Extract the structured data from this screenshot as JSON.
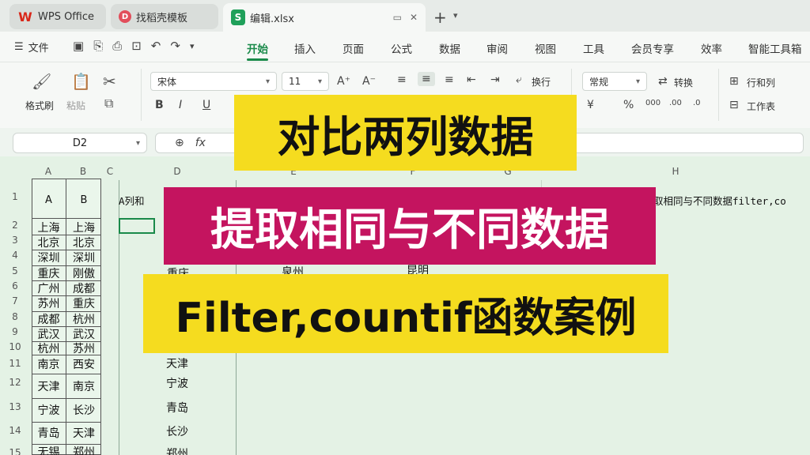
{
  "tabs": [
    {
      "label": "WPS Office",
      "icon": "wps-logo-icon"
    },
    {
      "label": "找稻壳模板",
      "icon": "docer-icon"
    },
    {
      "label": "编辑.xlsx",
      "icon": "spreadsheet-icon"
    }
  ],
  "tab_new": "+",
  "menu": {
    "file": "文件",
    "items": [
      "开始",
      "插入",
      "页面",
      "公式",
      "数据",
      "审阅",
      "视图",
      "工具",
      "会员专享",
      "效率",
      "智能工具箱"
    ],
    "active": "开始"
  },
  "ribbon": {
    "format_painter": "格式刷",
    "paste": "粘贴",
    "font_name": "宋体",
    "font_size": "11",
    "wrap": "换行",
    "number_format": "常规",
    "convert": "转换",
    "row_col": "行和列",
    "sheet": "工作表",
    "bold": "B",
    "italic": "I",
    "underline": "U",
    "currency": "¥",
    "percent": "%"
  },
  "formula_bar": {
    "name_box": "D2",
    "fx": "fx"
  },
  "columns": [
    "A",
    "B",
    "C",
    "D",
    "E",
    "F",
    "G",
    "H"
  ],
  "row_numbers": [
    "1",
    "2",
    "3",
    "4",
    "5",
    "6",
    "7",
    "8",
    "9",
    "10",
    "11",
    "12",
    "13",
    "14",
    "15"
  ],
  "table": {
    "header_a": "A",
    "header_b": "B",
    "col_a": [
      "上海",
      "北京",
      "深圳",
      "重庆",
      "广州",
      "苏州",
      "成都",
      "武汉",
      "杭州",
      "南京",
      "天津",
      "宁波",
      "青岛",
      "无锡"
    ],
    "col_b": [
      "上海",
      "北京",
      "深圳",
      "刚傲",
      "成都",
      "重庆",
      "杭州",
      "武汉",
      "苏州",
      "西安",
      "南京",
      "长沙",
      "天津",
      "郑州"
    ]
  },
  "d1_text": "A列和",
  "h1_text": "取相同与不同数据filter,co",
  "col_d_values": [
    "重庆",
    "天津",
    "宁波",
    "青岛",
    "长沙",
    "郑州"
  ],
  "col_e_partial": "泉州",
  "col_f_partial": "昆明",
  "banners": {
    "line1": "对比两列数据",
    "line2": "提取相同与不同数据",
    "line3": "Filter,countif函数案例"
  }
}
